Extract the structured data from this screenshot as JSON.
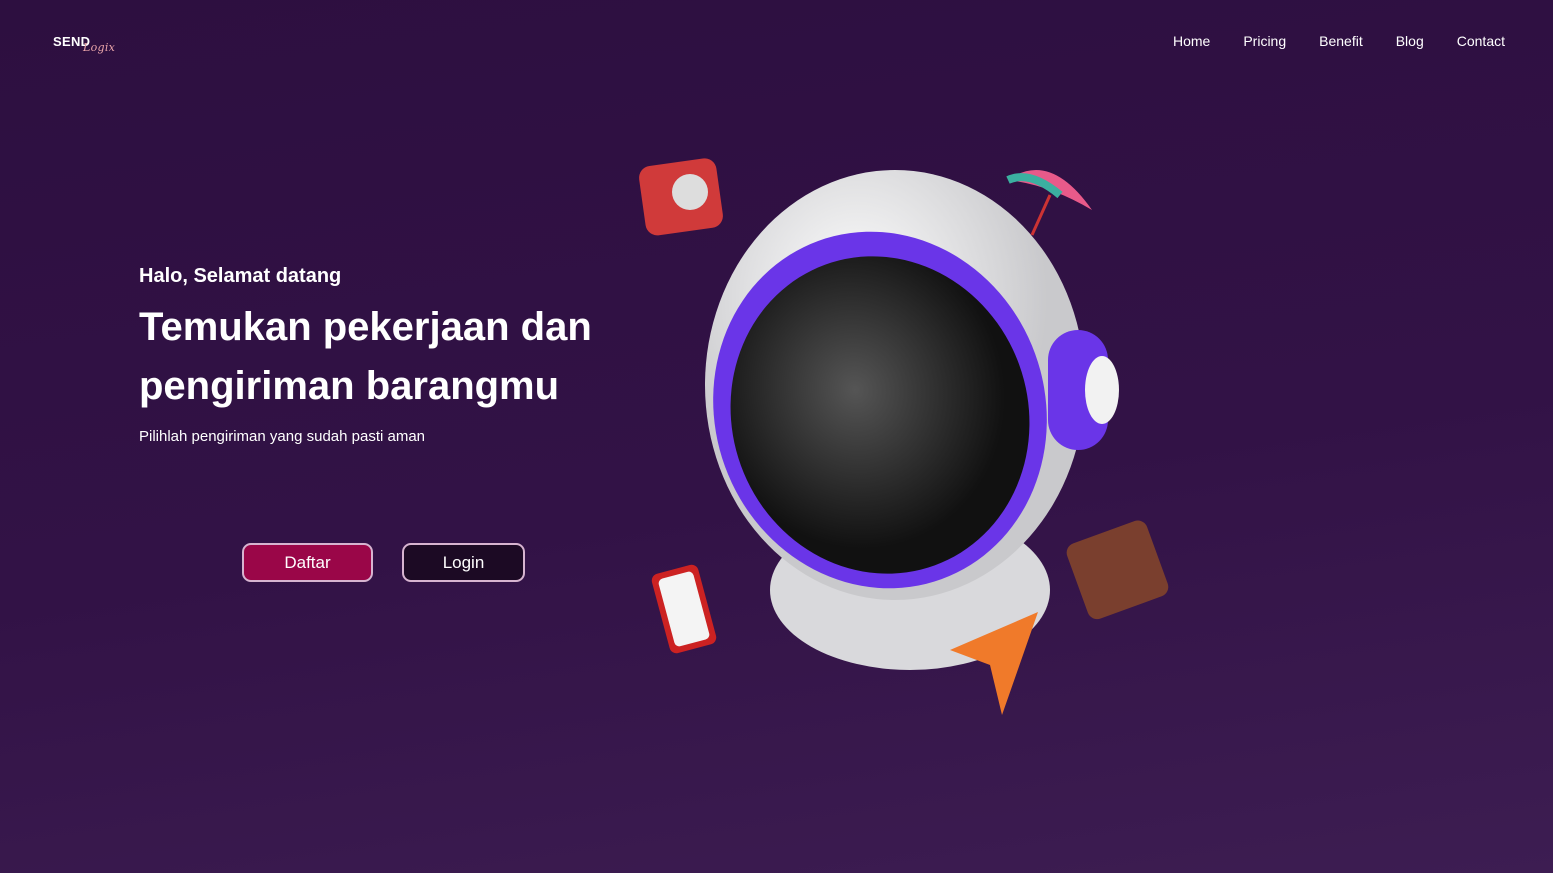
{
  "logo": {
    "main": "SEND",
    "script": "Logix"
  },
  "nav": [
    "Home",
    "Pricing",
    "Benefit",
    "Blog",
    "Contact"
  ],
  "hero": {
    "greeting": "Halo, Selamat datang",
    "title": "Temukan pekerjaan dan pengiriman barangmu",
    "subtitle": "Pilihlah pengiriman yang sudah pasti aman"
  },
  "buttons": {
    "daftar": "Daftar",
    "login": "Login"
  },
  "colors": {
    "daftar": "#9a0648",
    "login": "#1c0a24",
    "accent": "#6a35e8"
  }
}
